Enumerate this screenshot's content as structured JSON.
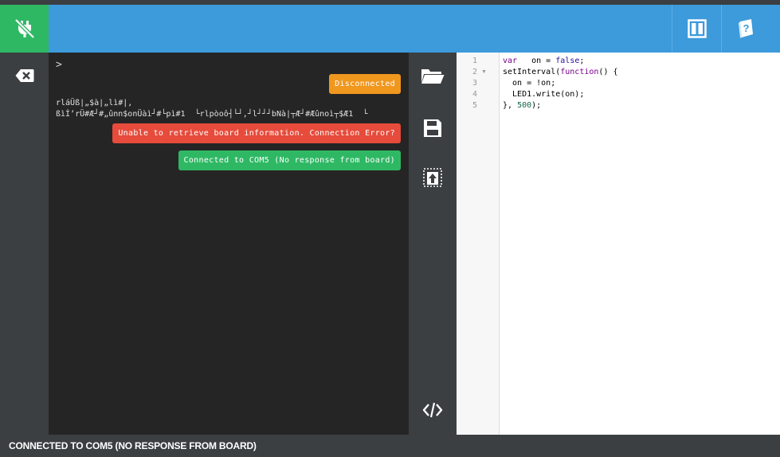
{
  "header": {
    "connect_icon": "plug-disconnected-icon",
    "split_icon": "split-view-icon",
    "help_icon": "help-book-icon"
  },
  "left_toolbar": {
    "clear_icon": "backspace-clear-icon"
  },
  "terminal": {
    "prompt": ">",
    "garbled_line_1": "rláÜß|„$à|„lì#|,",
    "garbled_line_2": "ßìİ’rÜ#Æ┘#„ûnn$onÜàì┘#└pì#1  └rlpòoô┤└┘,┘l┘┘┘bNà|┬Æ┘#Æûnoì┬$Æ1  └",
    "messages": [
      {
        "text": "Disconnected",
        "color": "#f0971e"
      },
      {
        "text": "Unable to retrieve board information. Connection Error?",
        "color": "#e64b3b"
      },
      {
        "text": "Connected to COM5 (No response from board)",
        "color": "#2fb864"
      }
    ]
  },
  "mid_toolbar": {
    "open_icon": "folder-open-icon",
    "save_icon": "save-disk-icon",
    "upload_icon": "upload-to-board-icon",
    "code_icon": "code-view-icon"
  },
  "editor": {
    "line_numbers": [
      "1",
      "2",
      "3",
      "4",
      "5"
    ],
    "lines": [
      [
        {
          "t": "var",
          "c": "kw"
        },
        {
          "t": "   on = ",
          "c": ""
        },
        {
          "t": "false",
          "c": "atom"
        },
        {
          "t": ";",
          "c": ""
        }
      ],
      [
        {
          "t": "setInterval(",
          "c": ""
        },
        {
          "t": "function",
          "c": "kw"
        },
        {
          "t": "() {",
          "c": ""
        }
      ],
      [
        {
          "t": "  on = !on;",
          "c": ""
        }
      ],
      [
        {
          "t": "  LED1.write(on);",
          "c": ""
        }
      ],
      [
        {
          "t": "}, ",
          "c": ""
        },
        {
          "t": "500",
          "c": "num"
        },
        {
          "t": ");",
          "c": ""
        }
      ]
    ]
  },
  "status": {
    "text": "CONNECTED TO COM5 (NO RESPONSE FROM BOARD)"
  },
  "colors": {
    "header": "#3d9adb",
    "connect": "#2fb864",
    "sidebar": "#3b3f42",
    "terminal": "#252525"
  }
}
